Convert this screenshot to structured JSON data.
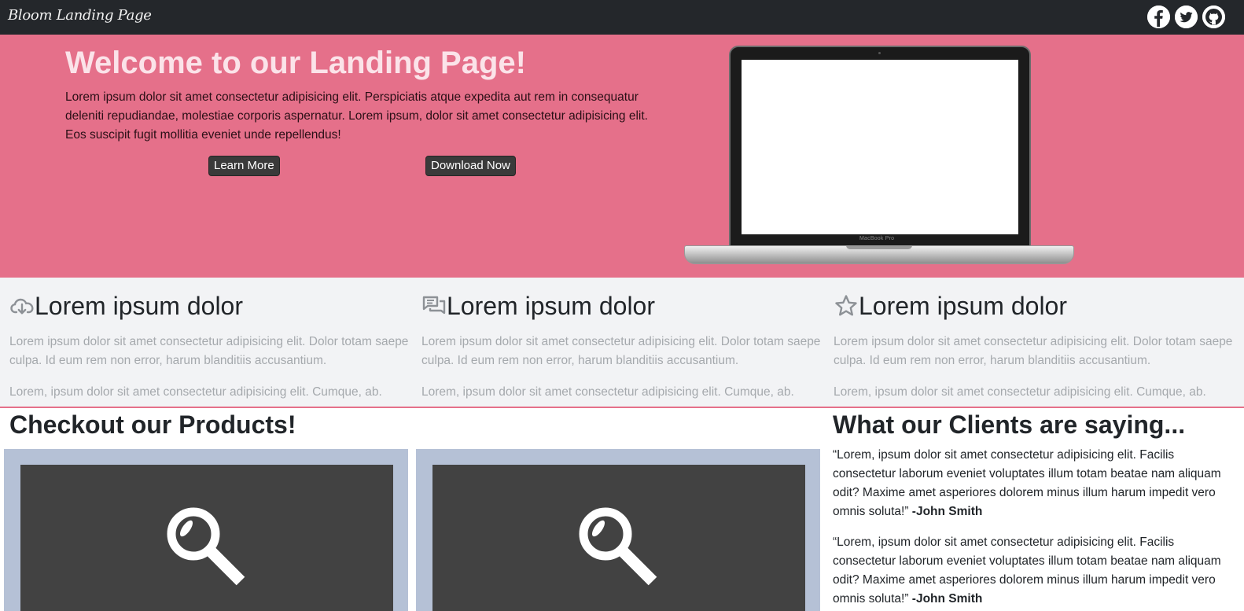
{
  "navbar": {
    "brand": "Bloom Landing Page",
    "social": [
      {
        "icon": "facebook-icon",
        "label": "Facebook"
      },
      {
        "icon": "twitter-icon",
        "label": "Twitter"
      },
      {
        "icon": "github-icon",
        "label": "GitHub"
      }
    ]
  },
  "hero": {
    "title": "Welcome to our Landing Page!",
    "text": "Lorem ipsum dolor sit amet consectetur adipisicing elit. Perspiciatis atque expedita aut rem in consequatur deleniti repudiandae, molestiae corporis aspernatur. Lorem ipsum, dolor sit amet consectetur adipisicing elit. Eos suscipit fugit mollitia eveniet unde repellendus!",
    "learn_more": "Learn More",
    "download_now": "Download Now",
    "laptop_label": "MacBook Pro"
  },
  "features": [
    {
      "icon": "cloud-download-icon",
      "title": "Lorem ipsum dolor",
      "p1": "Lorem ipsum dolor sit amet consectetur adipisicing elit. Dolor totam saepe culpa. Id eum rem non error, harum blanditiis accusantium.",
      "p2": "Lorem, ipsum dolor sit amet consectetur adipisicing elit. Cumque, ab."
    },
    {
      "icon": "chat-bubbles-icon",
      "title": "Lorem ipsum dolor",
      "p1": "Lorem ipsum dolor sit amet consectetur adipisicing elit. Dolor totam saepe culpa. Id eum rem non error, harum blanditiis accusantium.",
      "p2": "Lorem, ipsum dolor sit amet consectetur adipisicing elit. Cumque, ab."
    },
    {
      "icon": "star-icon",
      "title": "Lorem ipsum dolor",
      "p1": "Lorem ipsum dolor sit amet consectetur adipisicing elit. Dolor totam saepe culpa. Id eum rem non error, harum blanditiis accusantium.",
      "p2": "Lorem, ipsum dolor sit amet consectetur adipisicing elit. Cumque, ab."
    }
  ],
  "products": {
    "title": "Checkout our Products!",
    "items": [
      {
        "icon": "magnifier-icon"
      },
      {
        "icon": "magnifier-icon"
      }
    ]
  },
  "clients": {
    "title": "What our Clients are saying...",
    "quotes": [
      {
        "text": "“Lorem, ipsum dolor sit amet consectetur adipisicing elit. Facilis consectetur laborum eveniet voluptates illum totam beatae nam aliquam odit? Maxime amet asperiores dolorem minus illum harum impedit vero omnis soluta!”",
        "author": "-John Smith"
      },
      {
        "text": "“Lorem, ipsum dolor sit amet consectetur adipisicing elit. Facilis consectetur laborum eveniet voluptates illum totam beatae nam aliquam odit? Maxime amet asperiores dolorem minus illum harum impedit vero omnis soluta!”",
        "author": "-John Smith"
      }
    ]
  },
  "colors": {
    "navbar": "#24272b",
    "hero": "#e5708a",
    "features_bg": "#f2f3f5",
    "product_frame": "#b5c1d6",
    "product_inner": "#424242",
    "button": "#3a3a3a"
  }
}
